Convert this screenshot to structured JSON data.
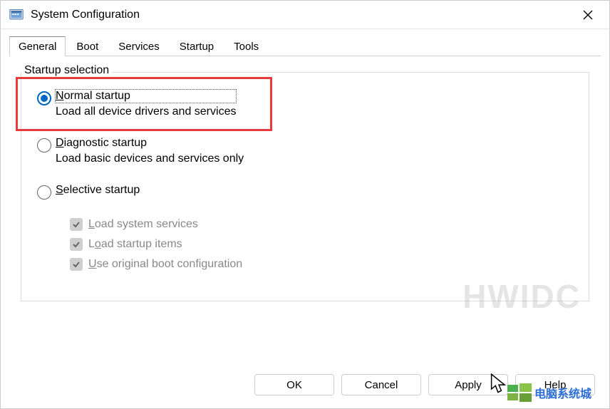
{
  "window": {
    "title": "System Configuration"
  },
  "tabs": {
    "general": "General",
    "boot": "Boot",
    "services": "Services",
    "startup": "Startup",
    "tools": "Tools"
  },
  "fieldset": {
    "legend": "Startup selection"
  },
  "options": {
    "normal": {
      "label": "Normal startup",
      "desc": "Load all device drivers and services"
    },
    "diagnostic": {
      "label": "Diagnostic startup",
      "desc": "Load basic devices and services only"
    },
    "selective": {
      "label": "Selective startup"
    }
  },
  "checks": {
    "loadServices": "Load system services",
    "loadStartup": "Load startup items",
    "useOriginal": "Use original boot configuration"
  },
  "buttons": {
    "ok": "OK",
    "cancel": "Cancel",
    "apply": "Apply",
    "help": "Help"
  },
  "watermark": {
    "w1": "HWIDC",
    "w2": "电脑系统城"
  }
}
